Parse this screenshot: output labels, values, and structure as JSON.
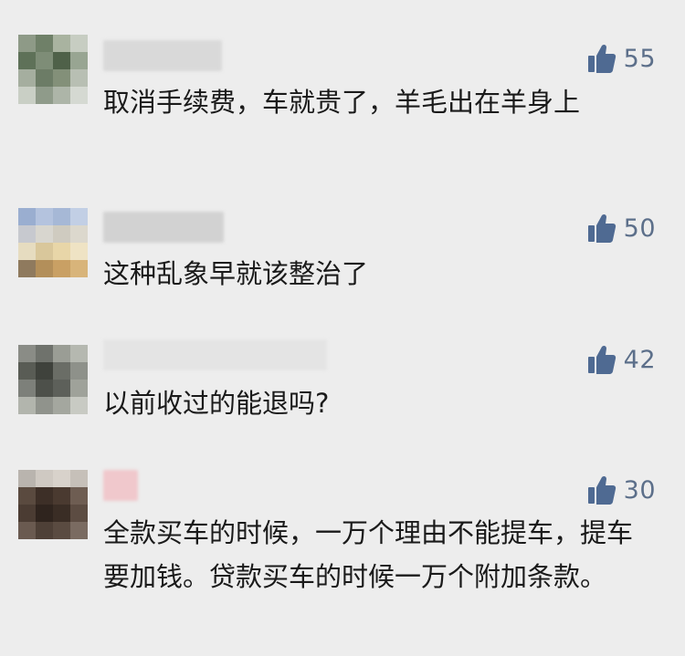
{
  "comments": [
    {
      "likes": "55",
      "text": "取消手续费，车就贵了，羊毛出在羊身上"
    },
    {
      "likes": "50",
      "text": "这种乱象早就该整治了"
    },
    {
      "likes": "42",
      "text": "以前收过的能退吗?"
    },
    {
      "likes": "30",
      "text": "全款买车的时候，一万个理由不能提车，提车要加钱。贷款买车的时候一万个附加条款。"
    }
  ],
  "colors": {
    "background": "#ededed",
    "like_icon": "#4f6a92",
    "like_count": "#5c6f8a",
    "text": "#1a1a1a"
  },
  "icons": {
    "like": "thumbs-up-icon"
  }
}
